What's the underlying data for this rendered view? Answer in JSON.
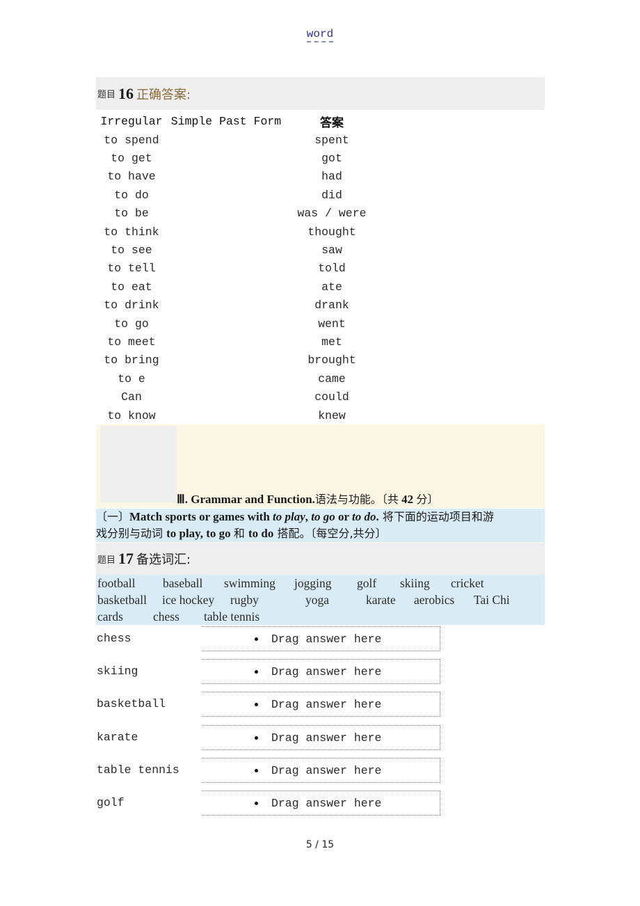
{
  "header": {
    "title": "word"
  },
  "question16": {
    "label": "题目",
    "number": "16",
    "title": "正确答案:",
    "columns": [
      "Irregular",
      "Simple Past Form",
      "答案"
    ],
    "rows": [
      {
        "verb": "to spend",
        "past": "spent"
      },
      {
        "verb": "to get",
        "past": "got"
      },
      {
        "verb": "to have",
        "past": "had"
      },
      {
        "verb": "to do",
        "past": "did"
      },
      {
        "verb": "to be",
        "past": "was / were"
      },
      {
        "verb": "to think",
        "past": "thought"
      },
      {
        "verb": "to see",
        "past": "saw"
      },
      {
        "verb": "to tell",
        "past": "told"
      },
      {
        "verb": "to eat",
        "past": "ate"
      },
      {
        "verb": "to drink",
        "past": "drank"
      },
      {
        "verb": "to go",
        "past": "went"
      },
      {
        "verb": "to meet",
        "past": "met"
      },
      {
        "verb": "to bring",
        "past": "brought"
      },
      {
        "verb": "to e",
        "past": "came"
      },
      {
        "verb": "Can",
        "past": "could"
      },
      {
        "verb": "to know",
        "past": "knew"
      }
    ]
  },
  "section3": {
    "numeral": "Ⅲ.",
    "title_en": "Grammar and Function.",
    "title_cn": "语法与功能。〔共",
    "points": "42",
    "points_suffix": "分〕"
  },
  "instruction": {
    "prefix": "〔一〕",
    "text_bold": "Match sports or games with ",
    "i1": "to play",
    "sep1": ", ",
    "i2": "to go",
    "sep2": " or ",
    "i3": "to do",
    "end": ".",
    "cn_line1": " 将下面的运动项目和游",
    "cn_line2_a": "戏分别与动词 ",
    "line2_b": "to play, to go ",
    "cn_line2_c": " 和 ",
    "line2_d": "to do",
    "cn_line2_e": " 搭配。〔每空分,共分〕"
  },
  "question17": {
    "label": "题目",
    "number": "17",
    "title": "备选词汇:",
    "word_bank": [
      "football",
      "baseball",
      "swimming",
      "jogging",
      "golf",
      "skiing",
      "cricket",
      "basketball",
      "ice hockey",
      "rugby",
      "yoga",
      "karate",
      "aerobics",
      "Tai Chi",
      "cards",
      "chess",
      "table tennis"
    ],
    "matches": [
      {
        "label": "chess",
        "placeholder": "Drag answer here"
      },
      {
        "label": "skiing",
        "placeholder": "Drag answer here"
      },
      {
        "label": "basketball",
        "placeholder": "Drag answer here"
      },
      {
        "label": "karate",
        "placeholder": "Drag answer here"
      },
      {
        "label": "table tennis",
        "placeholder": "Drag answer here"
      },
      {
        "label": "golf",
        "placeholder": "Drag answer here"
      }
    ]
  },
  "footer": {
    "page": "5",
    "separator": " / ",
    "total": "15"
  }
}
